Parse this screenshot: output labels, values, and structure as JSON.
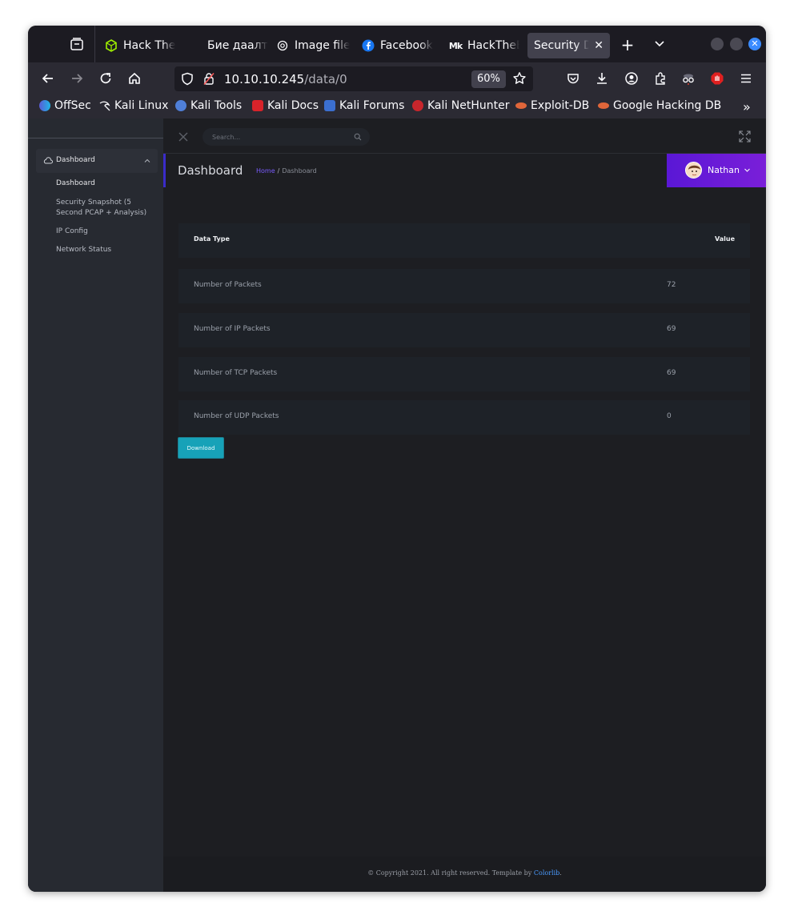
{
  "browser": {
    "tabs": [
      {
        "title": "Hack The",
        "icon": "hackthebox-cube-icon"
      },
      {
        "title": "Бие даалт",
        "icon": "none"
      },
      {
        "title": "Image file",
        "icon": "openai-icon"
      },
      {
        "title": "Facebook",
        "icon": "facebook-icon"
      },
      {
        "title": "HackTheB",
        "icon": "medium-icon"
      },
      {
        "title": "Security Da",
        "icon": "none"
      }
    ],
    "url_host": "10.10.10.245",
    "url_path": "/data/0",
    "zoom": "60%",
    "bookmarks": [
      {
        "label": "OffSec",
        "color": "#5b5bd6"
      },
      {
        "label": "Kali Linux",
        "color": "#2b2a33"
      },
      {
        "label": "Kali Tools",
        "color": "#4f7fd8"
      },
      {
        "label": "Kali Docs",
        "color": "#d8232a"
      },
      {
        "label": "Kali Forums",
        "color": "#3b6fd0"
      },
      {
        "label": "Kali NetHunter",
        "color": "#c8262c"
      },
      {
        "label": "Exploit-DB",
        "color": "#e0663a"
      },
      {
        "label": "Google Hacking DB",
        "color": "#e0663a"
      }
    ]
  },
  "sidebar": {
    "section": "Dashboard",
    "items": [
      "Dashboard",
      "Security Snapshot (5 Second PCAP + Analysis)",
      "IP Config",
      "Network Status"
    ]
  },
  "topbar": {
    "search_placeholder": "Search..."
  },
  "header": {
    "title": "Dashboard",
    "breadcrumb_home": "Home",
    "breadcrumb_sep": "/",
    "breadcrumb_current": "Dashboard",
    "user_name": "Nathan"
  },
  "table": {
    "headers": [
      "Data Type",
      "Value"
    ],
    "rows": [
      {
        "label": "Number of Packets",
        "value": "72"
      },
      {
        "label": "Number of IP Packets",
        "value": "69"
      },
      {
        "label": "Number of TCP Packets",
        "value": "69"
      },
      {
        "label": "Number of UDP Packets",
        "value": "0"
      }
    ]
  },
  "download_label": "Download",
  "footer": {
    "text": "© Copyright 2021. All right reserved. Template by",
    "link": "Colorlib",
    "end": "."
  },
  "colors": {
    "accent": "#7b1fd8",
    "button": "#17a2b8",
    "link": "#4a9bff"
  }
}
